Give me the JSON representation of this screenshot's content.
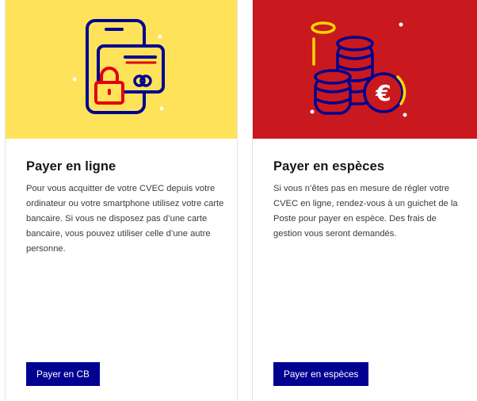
{
  "cards": [
    {
      "title": "Payer en ligne",
      "text": "Pour vous acquitter de votre CVEC depuis votre ordinateur ou votre smartphone utilisez votre carte bancaire. Si vous ne disposez pas d’une carte bancaire, vous pouvez utiliser celle d’une autre personne.",
      "button_label": "Payer en CB",
      "icon": "phone-card-lock-icon"
    },
    {
      "title": "Payer en espèces",
      "text": "Si vous n’êtes pas en mesure de régler votre CVEC en ligne, rendez-vous à un guichet de la Poste pour payer en espèce. Des frais de gestion vous seront demandés.",
      "button_label": "Payer en espèces",
      "icon": "coins-euro-icon"
    }
  ],
  "colors": {
    "yellow": "#fee35a",
    "red": "#c9191e",
    "blue": "#000091",
    "navy_stroke": "#000091"
  }
}
